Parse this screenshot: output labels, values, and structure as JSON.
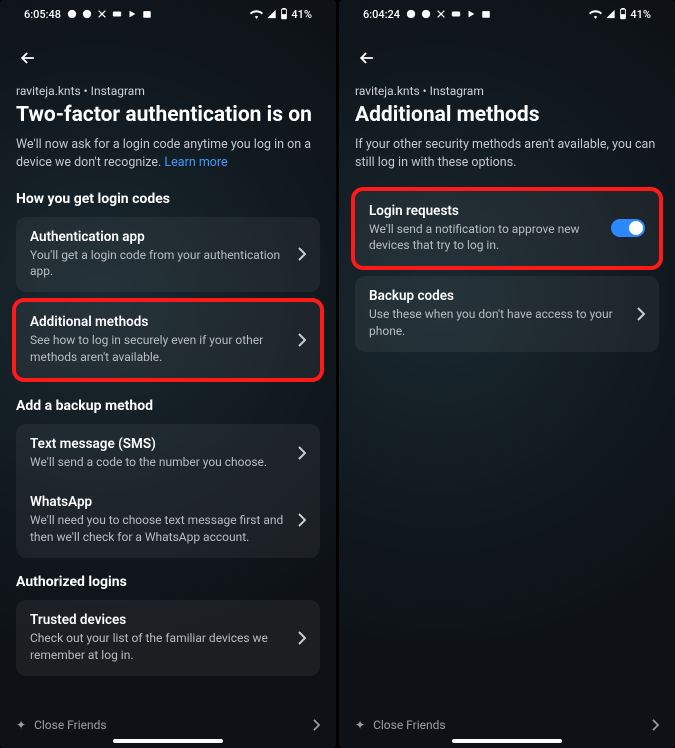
{
  "left": {
    "status": {
      "time": "6:05:48",
      "battery": "41%"
    },
    "breadcrumb": "raviteja.knts • Instagram",
    "title": "Two-factor authentication is on",
    "desc": "We'll now ask for a login code anytime you log in on a device we don't recognize. ",
    "learn_more": "Learn more",
    "sections": {
      "how_header": "How you get login codes",
      "auth_app": {
        "title": "Authentication app",
        "sub": "You'll get a login code from your authentication app."
      },
      "additional": {
        "title": "Additional methods",
        "sub": "See how to log in securely even if your other methods aren't available."
      },
      "backup_header": "Add a backup method",
      "sms": {
        "title": "Text message (SMS)",
        "sub": "We'll send a code to the number you choose."
      },
      "whatsapp": {
        "title": "WhatsApp",
        "sub": "We'll need you to choose text message first and then we'll check for a WhatsApp account."
      },
      "authorized_header": "Authorized logins",
      "trusted": {
        "title": "Trusted devices",
        "sub": "Check out your list of the familiar devices we remember at log in."
      }
    },
    "bottom_fragment": "Close Friends"
  },
  "right": {
    "status": {
      "time": "6:04:24",
      "battery": "41%"
    },
    "breadcrumb": "raviteja.knts • Instagram",
    "title": "Additional methods",
    "desc": "If your other security methods aren't available, you can still log in with these options.",
    "login_requests": {
      "title": "Login requests",
      "sub": "We'll send a notification to approve new devices that try to log in.",
      "toggle": true
    },
    "backup_codes": {
      "title": "Backup codes",
      "sub": "Use these when you don't have access to your phone."
    },
    "bottom_fragment": "Close Friends"
  }
}
